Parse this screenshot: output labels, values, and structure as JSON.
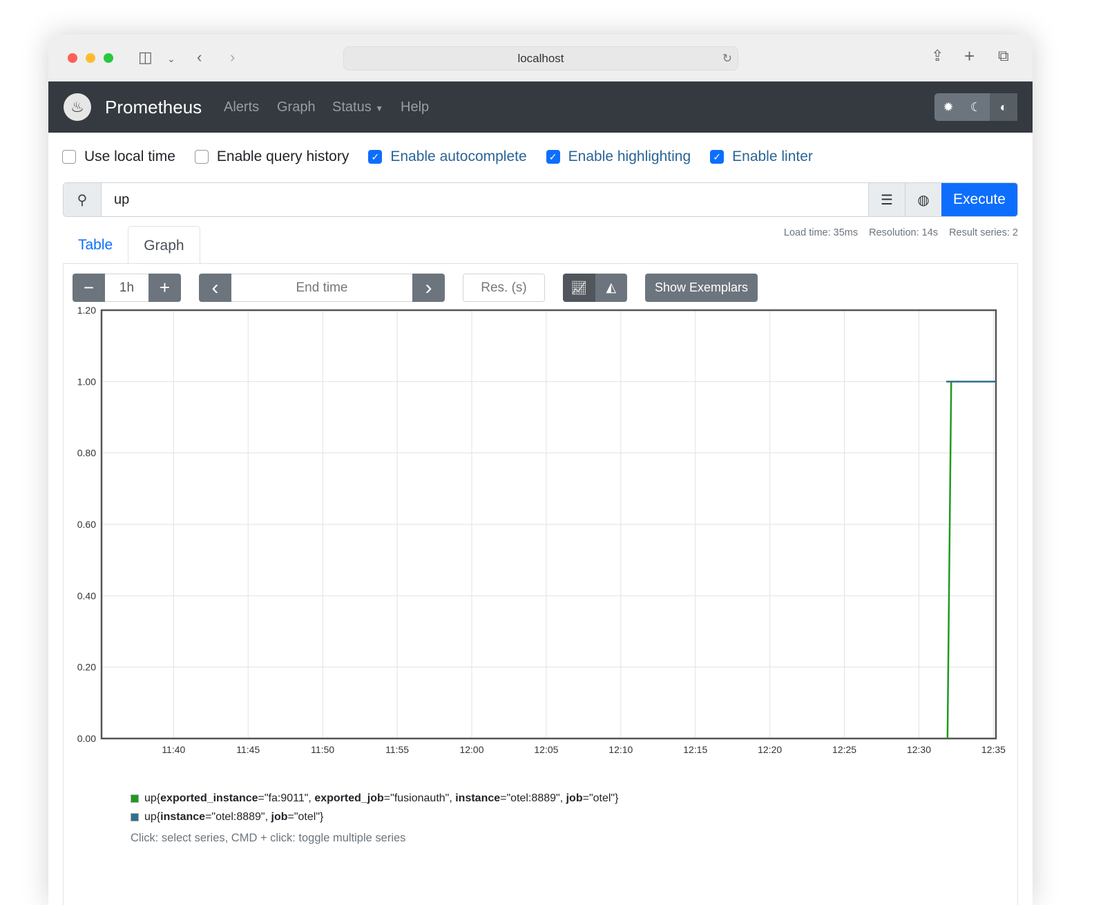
{
  "browser": {
    "url": "localhost"
  },
  "navbar": {
    "brand": "Prometheus",
    "items": [
      "Alerts",
      "Graph",
      "Status",
      "Help"
    ]
  },
  "options": [
    {
      "label": "Use local time",
      "checked": false
    },
    {
      "label": "Enable query history",
      "checked": false
    },
    {
      "label": "Enable autocomplete",
      "checked": true
    },
    {
      "label": "Enable highlighting",
      "checked": true
    },
    {
      "label": "Enable linter",
      "checked": true
    }
  ],
  "query": {
    "value": "up",
    "execute_label": "Execute"
  },
  "stats": {
    "load_time": "Load time: 35ms",
    "resolution": "Resolution: 14s",
    "result_series": "Result series: 2"
  },
  "tabs": {
    "table": "Table",
    "graph": "Graph"
  },
  "controls": {
    "minus": "−",
    "range": "1h",
    "plus": "+",
    "prev": "‹",
    "end_time_placeholder": "End time",
    "next": "›",
    "res_placeholder": "Res. (s)",
    "exemplars": "Show Exemplars"
  },
  "chart_data": {
    "type": "line",
    "x_range": [
      "11:35:10",
      "12:35:10"
    ],
    "ylim": [
      0,
      1.2
    ],
    "y_ticks": [
      "0.00",
      "0.20",
      "0.40",
      "0.60",
      "0.80",
      "1.00",
      "1.20"
    ],
    "x_ticks": [
      "11:40",
      "11:45",
      "11:50",
      "11:55",
      "12:00",
      "12:05",
      "12:10",
      "12:15",
      "12:20",
      "12:25",
      "12:30",
      "12:35"
    ],
    "series": [
      {
        "name": "up{exported_instance=\"fa:9011\", exported_job=\"fusionauth\", instance=\"otel:8889\", job=\"otel\"}",
        "color": "#1f9a1f",
        "points": [
          [
            "12:31:55",
            0
          ],
          [
            "12:32:10",
            1
          ]
        ]
      },
      {
        "name": "up{instance=\"otel:8889\", job=\"otel\"}",
        "color": "#2f6f8f",
        "points": [
          [
            "12:31:50",
            1
          ],
          [
            "12:35:10",
            1
          ]
        ]
      }
    ]
  },
  "legend": [
    {
      "parts": [
        [
          "up{",
          false
        ],
        [
          "exported_instance",
          true
        ],
        [
          "=\"fa:9011\", ",
          false
        ],
        [
          "exported_job",
          true
        ],
        [
          "=\"fusionauth\", ",
          false
        ],
        [
          "instance",
          true
        ],
        [
          "=\"otel:8889\", ",
          false
        ],
        [
          "job",
          true
        ],
        [
          "=\"otel\"}",
          false
        ]
      ]
    },
    {
      "parts": [
        [
          "up{",
          false
        ],
        [
          "instance",
          true
        ],
        [
          "=\"otel:8889\", ",
          false
        ],
        [
          "job",
          true
        ],
        [
          "=\"otel\"}",
          false
        ]
      ]
    }
  ],
  "hint": "Click: select series, CMD + click: toggle multiple series"
}
